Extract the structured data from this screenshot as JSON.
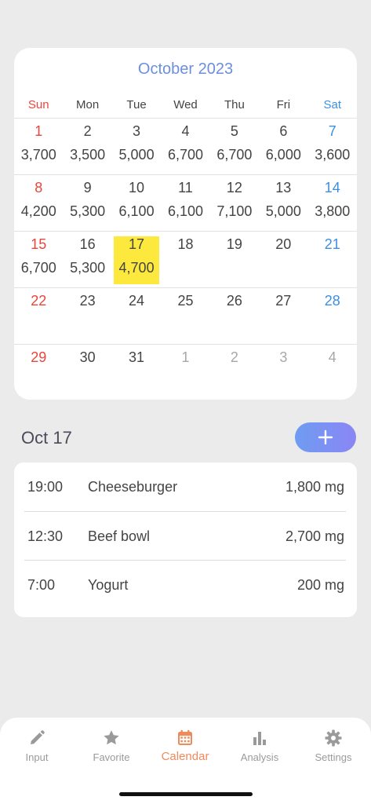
{
  "calendar": {
    "title": "October 2023",
    "weekdays": [
      "Sun",
      "Mon",
      "Tue",
      "Wed",
      "Thu",
      "Fri",
      "Sat"
    ],
    "weeks": [
      [
        {
          "d": "1",
          "v": "3,700"
        },
        {
          "d": "2",
          "v": "3,500"
        },
        {
          "d": "3",
          "v": "5,000"
        },
        {
          "d": "4",
          "v": "6,700"
        },
        {
          "d": "5",
          "v": "6,700"
        },
        {
          "d": "6",
          "v": "6,000"
        },
        {
          "d": "7",
          "v": "3,600"
        }
      ],
      [
        {
          "d": "8",
          "v": "4,200"
        },
        {
          "d": "9",
          "v": "5,300"
        },
        {
          "d": "10",
          "v": "6,100"
        },
        {
          "d": "11",
          "v": "6,100"
        },
        {
          "d": "12",
          "v": "7,100"
        },
        {
          "d": "13",
          "v": "5,000"
        },
        {
          "d": "14",
          "v": "3,800"
        }
      ],
      [
        {
          "d": "15",
          "v": "6,700"
        },
        {
          "d": "16",
          "v": "5,300"
        },
        {
          "d": "17",
          "v": "4,700",
          "selected": true
        },
        {
          "d": "18",
          "v": ""
        },
        {
          "d": "19",
          "v": ""
        },
        {
          "d": "20",
          "v": ""
        },
        {
          "d": "21",
          "v": ""
        }
      ],
      [
        {
          "d": "22",
          "v": ""
        },
        {
          "d": "23",
          "v": ""
        },
        {
          "d": "24",
          "v": ""
        },
        {
          "d": "25",
          "v": ""
        },
        {
          "d": "26",
          "v": ""
        },
        {
          "d": "27",
          "v": ""
        },
        {
          "d": "28",
          "v": ""
        }
      ],
      [
        {
          "d": "29",
          "v": ""
        },
        {
          "d": "30",
          "v": ""
        },
        {
          "d": "31",
          "v": ""
        },
        {
          "d": "1",
          "v": "",
          "other": true
        },
        {
          "d": "2",
          "v": "",
          "other": true
        },
        {
          "d": "3",
          "v": "",
          "other": true
        },
        {
          "d": "4",
          "v": "",
          "other": true
        }
      ]
    ]
  },
  "day_detail": {
    "heading": "Oct 17",
    "add_icon": "plus-icon",
    "entries": [
      {
        "time": "19:00",
        "food": "Cheeseburger",
        "amount": "1,800 mg"
      },
      {
        "time": "12:30",
        "food": "Beef bowl",
        "amount": "2,700 mg"
      },
      {
        "time": "7:00",
        "food": "Yogurt",
        "amount": "200 mg"
      }
    ]
  },
  "tabs": [
    {
      "label": "Input",
      "icon": "pencil-icon"
    },
    {
      "label": "Favorite",
      "icon": "star-icon"
    },
    {
      "label": "Calendar",
      "icon": "calendar-icon",
      "active": true
    },
    {
      "label": "Analysis",
      "icon": "bar-chart-icon"
    },
    {
      "label": "Settings",
      "icon": "gear-icon"
    }
  ],
  "colors": {
    "accent": "#ef8a5c",
    "title_blue": "#6c8fdc",
    "sunday": "#e8453c",
    "saturday": "#3d8fe0",
    "highlight": "#fde93e"
  }
}
